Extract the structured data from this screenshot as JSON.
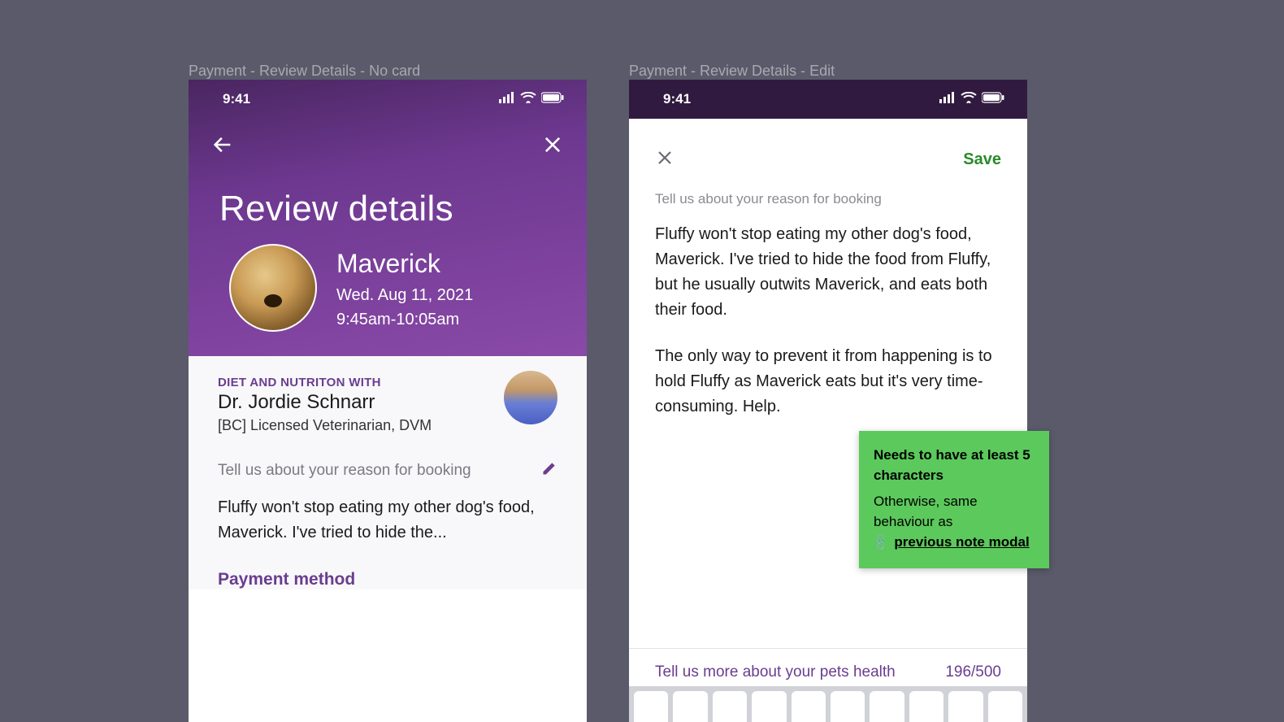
{
  "frames": {
    "left_label": "Payment - Review Details - No card",
    "right_label": "Payment - Review Details - Edit"
  },
  "status": {
    "time": "9:41"
  },
  "review": {
    "title": "Review details",
    "pet_name": "Maverick",
    "date": "Wed. Aug 11, 2021",
    "time_range": "9:45am-10:05am",
    "topic_label": "DIET AND NUTRITON WITH",
    "doctor_name": "Dr. Jordie Schnarr",
    "doctor_cred": "[BC] Licensed Veterinarian, DVM",
    "reason_label": "Tell us about your reason for booking",
    "reason_preview": "Fluffy won't stop eating my other dog's food, Maverick. I've tried to hide the...",
    "payment_section": "Payment method"
  },
  "modal": {
    "save_label": "Save",
    "label": "Tell us about your reason for booking",
    "text_p1": "Fluffy won't stop eating my other dog's food, Maverick. I've tried to hide the food from Fluffy, but he usually outwits Maverick, and eats both their food.",
    "text_p2": "The only way to prevent it from happening is to hold Fluffy as Maverick eats but it's very time-consuming. Help.",
    "footer_label": "Tell us more about your pets health",
    "char_count": "196/500"
  },
  "sticky": {
    "bold": "Needs to have at least 5 characters",
    "line1": "Otherwise, same behaviour as",
    "link": "previous note modal"
  }
}
